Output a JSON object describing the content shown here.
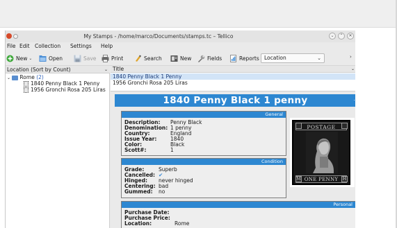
{
  "window": {
    "title": "My Stamps - /home/marco/Documents/stamps.tc – Tellico",
    "buttons": [
      "⌄",
      "⌃",
      "✕"
    ]
  },
  "menu": {
    "file": "File",
    "edit": "Edit",
    "collection": "Collection",
    "settings": "Settings",
    "help": "Help"
  },
  "toolbar": {
    "new_label": "New",
    "open_label": "Open",
    "save_label": "Save",
    "print_label": "Print",
    "search_label": "Search",
    "new_entry_label": "New",
    "fields_label": "Fields",
    "reports_label": "Reports",
    "group_select_value": "Location",
    "more": "›"
  },
  "left_pane": {
    "header": "Location (Sort by Count)",
    "group_name": "Rome",
    "group_count": "(2)",
    "items": [
      "1840 Penny Black 1 Penny",
      "1956 Gronchi Rosa 205 Liras"
    ]
  },
  "list": {
    "column_title": "Title",
    "rows": [
      "1840 Penny Black 1 Penny",
      "1956 Gronchi Rosa 205 Liras"
    ]
  },
  "detail": {
    "title": "1840 Penny Black 1 penny",
    "title_mark": "·",
    "general": {
      "header": "General",
      "fields": [
        {
          "label": "Description:",
          "value": "Penny Black"
        },
        {
          "label": "Denomination:",
          "value": "1 penny"
        },
        {
          "label": "Country:",
          "value": "England"
        },
        {
          "label": "Issue Year:",
          "value": "1840"
        },
        {
          "label": "Color:",
          "value": "Black"
        },
        {
          "label": "Scott#:",
          "value": "1"
        }
      ]
    },
    "condition": {
      "header": "Condition",
      "grade_label": "Grade:",
      "grade_value": "Superb",
      "cancelled_label": "Cancelled:",
      "cancelled_value": "✔",
      "hinged_label": "Hinged:",
      "hinged_value": "never hinged",
      "centering_label": "Centering:",
      "centering_value": "bad",
      "gummed_label": "Gummed:",
      "gummed_value": "no"
    },
    "personal": {
      "header": "Personal",
      "purchase_date_label": "Purchase Date:",
      "purchase_price_label": "Purchase Price:",
      "location_label": "Location:",
      "location_value": "Rome"
    },
    "stamp_image": {
      "top_text": "POSTAGE",
      "bottom_text": "ONE PENNY",
      "corner_tl": "",
      "corner_tr": "",
      "corner_bl": "M",
      "corner_br": "H"
    }
  },
  "colors": {
    "accent": "#2d87d1",
    "selection": "#d2e4f7",
    "link": "#2c5fb8"
  }
}
